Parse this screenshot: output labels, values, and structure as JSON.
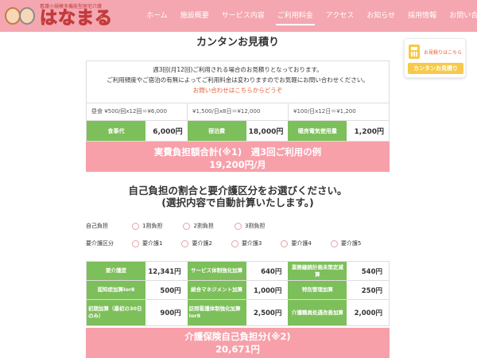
{
  "header": {
    "logo_sub": "看護小規模多機能型居宅介護",
    "logo_text": "はなまる",
    "nav": [
      {
        "label": "ホーム"
      },
      {
        "label": "施設概要"
      },
      {
        "label": "サービス内容"
      },
      {
        "label": "ご利用料金",
        "active": true
      },
      {
        "label": "アクセス"
      },
      {
        "label": "お知らせ"
      },
      {
        "label": "採用情報"
      },
      {
        "label": "お問い合わせ"
      }
    ]
  },
  "page_title": "カンタンお見積り",
  "intro": {
    "line1": "週3回(月12回)ご利用される場合のお見積りとなっております。",
    "line2": "ご利用頻度やご宿泊の有無によってご利用料金は変わりますのでお気軽にお問い合わせください。",
    "link": "お問い合わせはこちらからどうぞ"
  },
  "prices": [
    "昼食 ¥500/回x12回＝¥6,000",
    "¥1,500/日x8日＝¥12,000",
    "¥100/日x12日＝¥1,200"
  ],
  "costs": [
    {
      "label": "食事代",
      "value": "6,000円"
    },
    {
      "label": "宿泊費",
      "value": "18,000円"
    },
    {
      "label": "暖房電気使用量",
      "value": "1,200円"
    }
  ],
  "total": {
    "line1": "実費負担額合計(※1)　週3回ご利用の例",
    "line2": "19,200円/月"
  },
  "select_section": {
    "line1": "自己負担の割合と要介護区分をお選びください。",
    "line2": "(選択内容で自動計算いたします。)"
  },
  "self_burden": {
    "label": "自己負担",
    "options": [
      "1割負担",
      "2割負担",
      "3割負担"
    ]
  },
  "care_level": {
    "label": "要介護区分",
    "options": [
      "要介護1",
      "要介護2",
      "要介護3",
      "要介護4",
      "要介護5"
    ]
  },
  "care_grid": [
    [
      {
        "label": "要介護度",
        "value": "12,341円"
      },
      {
        "label": "サービス体制強化加算",
        "value": "640円"
      },
      {
        "label": "業務継続計画未策定減算",
        "value": "540円"
      }
    ],
    [
      {
        "label": "認知症加算ⅠorⅡ",
        "value": "500円"
      },
      {
        "label": "総合マネジメント加算",
        "value": "1,000円"
      },
      {
        "label": "特別管理加算",
        "value": "250円"
      }
    ],
    [
      {
        "label": "初期加算（最初の30日のみ）",
        "value": "900円"
      },
      {
        "label": "訪問看護体制強化加算ⅠorⅡ",
        "value": "2,500円"
      },
      {
        "label": "介護職員処遇改善加算",
        "value": "2,000円"
      }
    ]
  ],
  "care_total": {
    "line1": "介護保険自己負担分(※2)",
    "line2": "20,671円"
  },
  "float_widget": {
    "text": "お見積りはこちら",
    "button": "カンタンお見積り"
  },
  "colors": {
    "header_pink": "#f4a7b0",
    "total_pink": "#f7a0aa",
    "label_green": "#7dbf5a",
    "link_orange": "#e85a2e",
    "accent_yellow": "#f7c948"
  }
}
